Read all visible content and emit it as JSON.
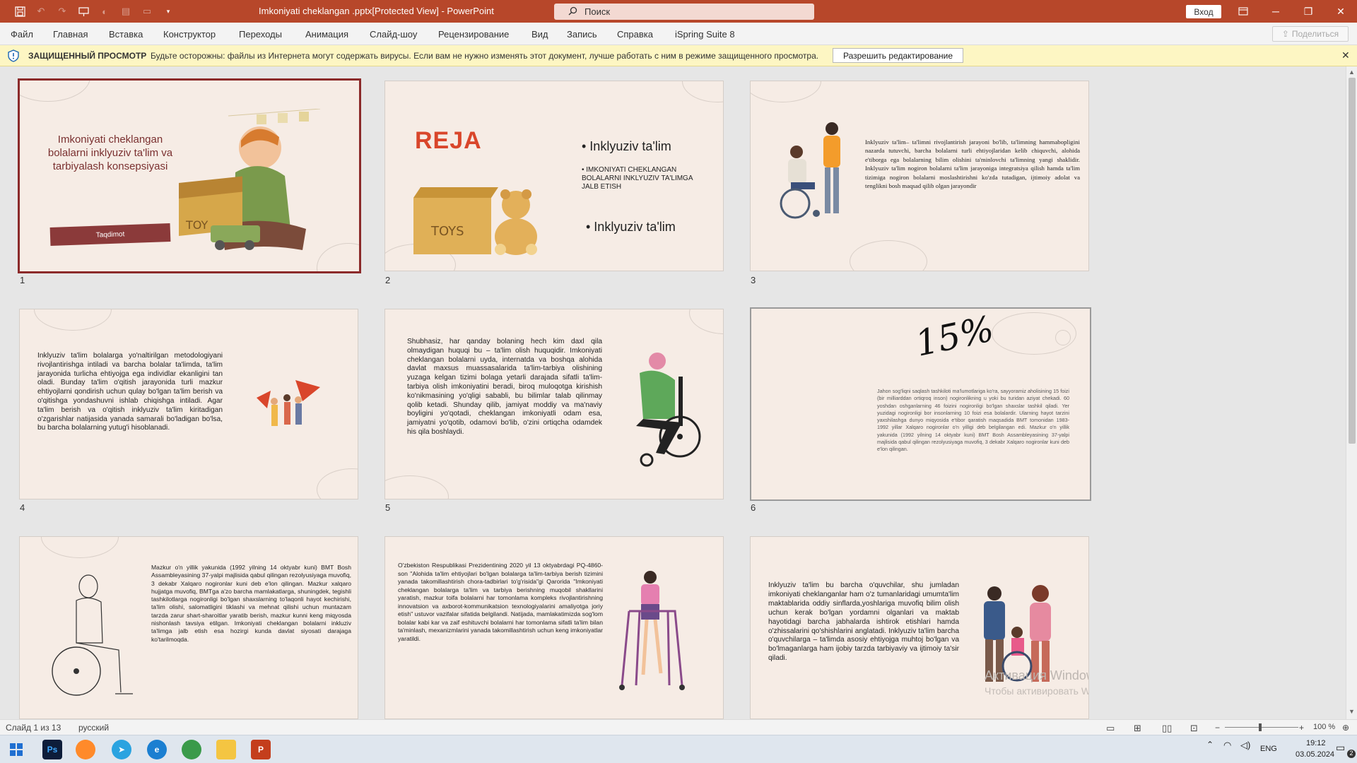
{
  "titlebar": {
    "document_title": "Imkoniyati cheklangan .pptx[Protected View] - PowerPoint",
    "search_placeholder": "Поиск",
    "signin_label": "Вход"
  },
  "ribbon": {
    "tabs": [
      "Файл",
      "Главная",
      "Вставка",
      "Конструктор",
      "Переходы",
      "Анимация",
      "Слайд-шоу",
      "Рецензирование",
      "Вид",
      "Запись",
      "Справка",
      "iSpring Suite 8"
    ],
    "share_label": "Поделиться"
  },
  "protected_bar": {
    "title": "ЗАЩИЩЕННЫЙ ПРОСМОТР",
    "message": "Будьте осторожны: файлы из Интернета могут содержать вирусы. Если вам не нужно изменять этот документ, лучше работать с ним в режиме защищенного просмотра.",
    "enable_button": "Разрешить редактирование"
  },
  "slides": [
    {
      "number": "1",
      "title": "Imkoniyati cheklangan bolalarni inklyuziv ta'lim va tarbiyalash konsepsiyasi",
      "button": "Taqdimot"
    },
    {
      "number": "2",
      "heading": "REJA",
      "bullet1": "• Inklyuziv ta'lim",
      "bullet2": "• IMKONIYATI CHEKLANGAN BOLALARNI INKLYUZIV TA'LIMGA JALB ETISH",
      "bullet3": "• Inklyuziv ta'lim",
      "toy_label": "TOYS"
    },
    {
      "number": "3",
      "text": "Inklyuziv ta'lim– ta'limni rivojlantirish jarayoni bo'lib, ta'limning hammabopligini nazarda tutuvchi, barcha bolalarni turli ehtiyojlaridan kelib chiquvchi, alohida e'tiborga ega bolalarning bilim olishini ta'minlovchi ta'limning yangi shaklidir. Inklyuziv ta'lim nogiron bolalarni ta'lim jarayoniga integratsiya qilish hamda ta'lim tizimiga nogiron bolalarni moslashtirishni ko'zda tutadigan, ijtimoiy adolat va tenglikni bosh maqsad qilib olgan jarayondir"
    },
    {
      "number": "4",
      "text": "Inklyuziv ta'lim bolalarga yo'naltirilgan metodologiyani rivojlantirishga intiladi va barcha bolalar ta'limda, ta'lim jarayonida turlicha ehtiyojga ega individlar ekanligini tan oladi. Bunday ta'lim o'qitish jarayonida turli mazkur ehtiyojlarni qondirish uchun qulay bo'lgan ta'lim berish va o'qitishga yondashuvni ishlab chiqishga intiladi. Agar ta'lim berish va o'qitish inklyuziv ta'lim kiritadigan o'zgarishlar natijasida yanada samarali bo'ladigan bo'lsa, bu barcha bolalarning yutug'i hisoblanadi."
    },
    {
      "number": "5",
      "text": "Shubhasiz, har qanday bolaning hech kim daxl qila olmaydigan huquqi bu – ta'lim olish huquqidir. Imkoniyati cheklangan bolalarni uyda, internatda va boshqa alohida davlat maxsus muassasalarida ta'lim-tarbiya olishining yuzaga kelgan tizimi bolaga yetarli darajada sifatli ta'lim-tarbiya olish imkoniyatini beradi, biroq muloqotga kirishish ko'nikmasining yo'qligi sababli, bu bilimlar talab qilinmay qolib ketadi. Shunday qilib, jamiyat moddiy va ma'naviy boyligini yo'qotadi, cheklangan imkoniyatli odam esa, jamiyatni yo'qotib, odamovi bo'lib, o'zini ortiqcha odamdek his qila boshlaydi."
    },
    {
      "number": "6",
      "big": "15%",
      "text": "Jahon sog'liqni saqlash tashkiloti ma'lumotlariga ko'ra, sayyoramiz aholisining 15 foizi (bir milliarddan ortiqroq inson) nogironlikning u yoki bu turidan aziyat chekadi. 60 yoshdan oshganlarning 46 foizini nogironligi bo'lgan shaxslar tashkil qiladi. Yer yuzidagi nogironligi bor insonlarning 10 foizi esa bolalardir. Ularning hayot tarzini yaxshilashga dunyo miqyosida e'tibor qaratish maqsadida BMT tomonidan 1983-1992 yillar Xalqaro nogironlar o'n yilligi deb belgilangan edi. Mazkur o'n yillik yakunida (1992 yilning 14 oktyabr kuni) BMT Bosh Assambleyasining 37-yalpi majlisida qabul qilingan rezolyusiyaga muvofiq, 3 dekabr Xalqaro nogironlar kuni deb e'lon qilingan."
    },
    {
      "number": "7",
      "text": "Mazkur o'n yillik yakunida (1992 yilning 14 oktyabr kuni) BMT Bosh Assambleyasining 37-yalpi majlisida qabul qilingan rezolyusiyaga muvofiq, 3 dekabr Xalqaro nogironlar kuni deb e'lon qilingan. Mazkur xalqaro hujjatga muvofiq, BMTga a'zo barcha mamlakatlarga, shuningdek, tegishli tashkilotlarga nogironligi bo'lgan shaxslarning to'laqonli hayot kechirishi, ta'lim olishi, salomatligini tiklashi va mehnat qilishi uchun muntazam tarzda zarur shart-sharoitlar yaratib berish, mazkur kunni keng miqyosda nishonlash tavsiya etilgan. Imkoniyati cheklangan bolalarni inkluziv ta'limga jalb etish esa hozirgi kunda davlat siyosati darajaga ko'tarilmoqda."
    },
    {
      "number": "8",
      "text": "O'zbekiston Respublikasi Prezidentining 2020 yil 13 oktyabrdagi PQ-4860-son \"Alohida ta'lim ehtiyojlari bo'lgan bolalarga ta'lim-tarbiya berish tizimini yanada takomillashtirish chora-tadbirlari to'g'risida\"gi Qarorida \"Imkoniyati cheklangan bolalarga ta'lim va tarbiya berishning muqobil shakllarini yaratish, mazkur toifa bolalarni har tomonlama kompleks rivojlantirishning innovatsion va axborot-kommunikatsion texnologiyalarini amaliyotga joriy etish\" ustuvor vazifalar sifatida belgilandi. Natijada, mamlakatimizda sog'lom bolalar kabi kar va zaif eshituvchi bolalarni har tomonlama sifatli ta'lim bilan ta'minlash, mexanizmlarini yanada takomillashtirish uchun keng imkoniyatlar yaratildi."
    },
    {
      "number": "9",
      "text": "Inklyuziv ta'lim bu barcha o'quvchilar, shu jumladan imkoniyati cheklanganlar ham o'z tumanlaridagi umumta'lim maktablarida oddiy sinflarda,yoshlariga muvofiq bilim olish uchun kerak bo'lgan yordamni olganlari va maktab hayotidagi barcha jabhalarda ishtirok etishlari hamda o'zhissalarini qo'shishlarini anglatadi. Inklyuziv ta'lim barcha o'quvchilarga – ta'limda asosiy ehtiyojga muhtoj bo'lgan va bo'lmaganlarga ham ijobiy tarzda tarbiyaviy va ijtimoiy ta'sir qiladi."
    }
  ],
  "watermark": {
    "line1": "Активация Windows",
    "line2": "Чтобы активировать Windows, перейдите в раздел \"Параметры\"."
  },
  "statusbar": {
    "slide_counter": "Слайд 1 из 13",
    "language": "русский",
    "zoom": "100 %"
  },
  "taskbar": {
    "lang": "ENG",
    "time": "19:12",
    "date": "03.05.2024",
    "badge": "2"
  },
  "colors": {
    "accent": "#b7472a",
    "slide_bg": "#f6ece5",
    "reja": "#d9462b",
    "maroon": "#8b3a3a"
  }
}
